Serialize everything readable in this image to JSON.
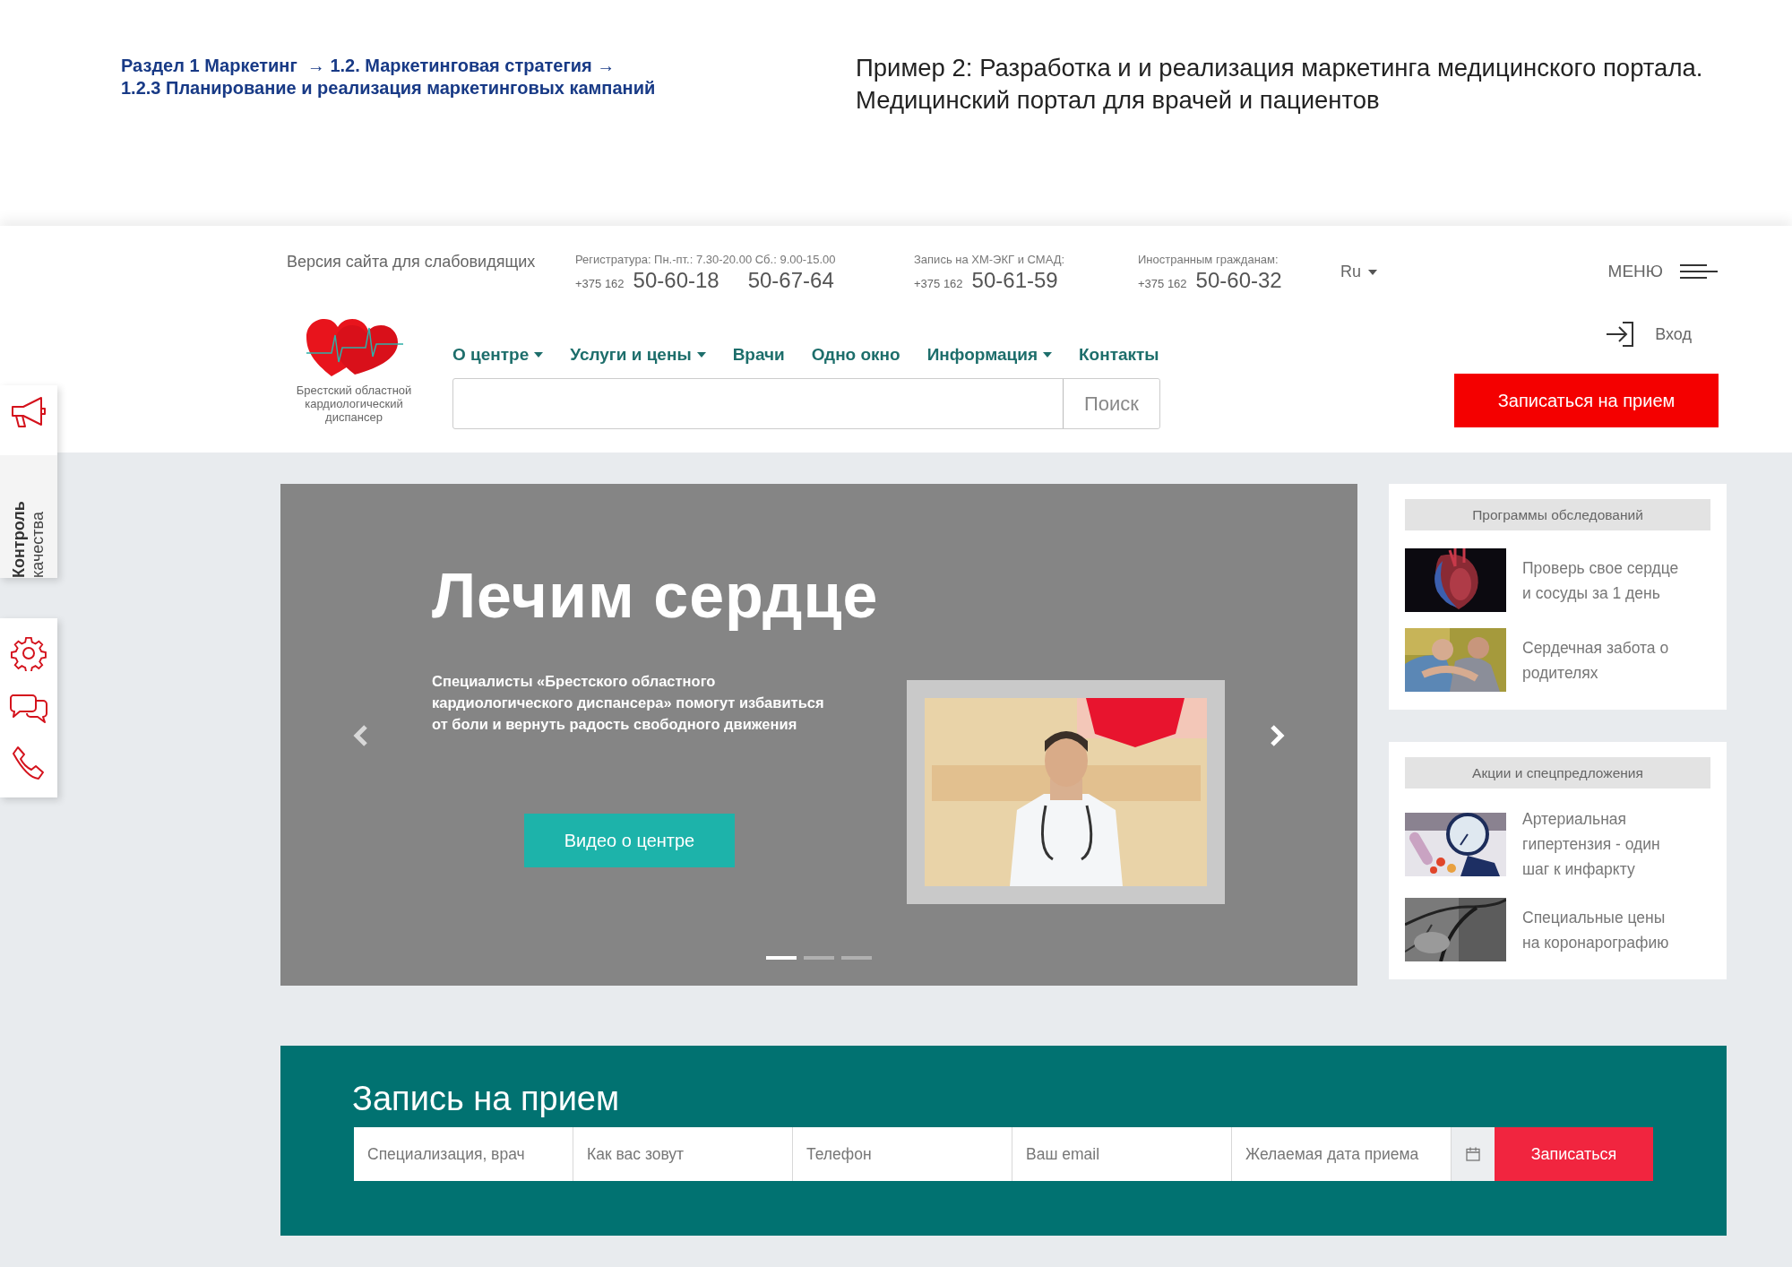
{
  "breadcrumb": [
    "Раздел 1 Маркетинг  → 1.2. Маркетинговая стратегия →",
    "1.2.3 Планирование и реализация маркетинговых кампаний"
  ],
  "heading": [
    "Пример 2: Разработка и и реализация маркетинга медицинского портала.",
    "Медицинский портал для врачей и пациентов"
  ],
  "site": {
    "top_bar": {
      "low_vision_link": "Версия сайта для слабовидящих",
      "contacts": [
        {
          "label": "Регистратура: Пн.-пт.: 7.30-20.00 Сб.: 9.00-15.00",
          "code": "+375 162",
          "numbers": [
            "50-60-18",
            "50-67-64"
          ]
        },
        {
          "label": "Запись на ХМ-ЭКГ и СМАД:",
          "code": "+375 162",
          "numbers": [
            "50-61-59"
          ]
        },
        {
          "label": "Иностранным гражданам:",
          "code": "+375 162",
          "numbers": [
            "50-60-32"
          ]
        }
      ],
      "language": "Ru",
      "menu_label": "МЕНЮ"
    },
    "logo": {
      "caption": [
        "Брестский областной",
        "кардиологический",
        "диспансер"
      ]
    },
    "nav": [
      {
        "label": "О центре",
        "dropdown": true
      },
      {
        "label": "Услуги и цены",
        "dropdown": true
      },
      {
        "label": "Врачи",
        "dropdown": false
      },
      {
        "label": "Одно окно",
        "dropdown": false
      },
      {
        "label": "Информация",
        "dropdown": true
      },
      {
        "label": "Контакты",
        "dropdown": false
      }
    ],
    "search": {
      "button": "Поиск"
    },
    "login": "Вход",
    "appointment_button": "Записаться на прием",
    "side_panel": {
      "label_bold": "Контроль",
      "label": "качества"
    },
    "hero": {
      "title": "Лечим сердце",
      "text": [
        "Специалисты «Брестского областного",
        "кардиологического диспансера» помогут избавиться",
        "от боли и вернуть радость свободного движения"
      ],
      "button": "Видео о центре",
      "slides": [
        {
          "selected": true
        },
        {
          "selected": false
        },
        {
          "selected": false
        }
      ]
    },
    "side_cards": [
      {
        "title": "Программы обследований",
        "items": [
          {
            "text": [
              "Проверь свое сердце",
              "и сосуды за 1 день"
            ]
          },
          {
            "text": [
              "Сердечная забота о",
              "родителях"
            ]
          }
        ]
      },
      {
        "title": "Акции и спецпредложения",
        "items": [
          {
            "text": [
              "Артериальная",
              "гипертензия - один",
              "шаг к инфаркту"
            ]
          },
          {
            "text": [
              "Специальные цены",
              "на коронарографию"
            ]
          }
        ]
      }
    ],
    "booking": {
      "title": "Запись на прием",
      "fields": [
        {
          "placeholder": "Специализация, врач"
        },
        {
          "placeholder": "Как вас зовут"
        },
        {
          "placeholder": "Телефон"
        },
        {
          "placeholder": "Ваш email"
        },
        {
          "placeholder": "Желаемая дата приема",
          "kind": "date"
        }
      ],
      "submit": "Записаться"
    }
  }
}
